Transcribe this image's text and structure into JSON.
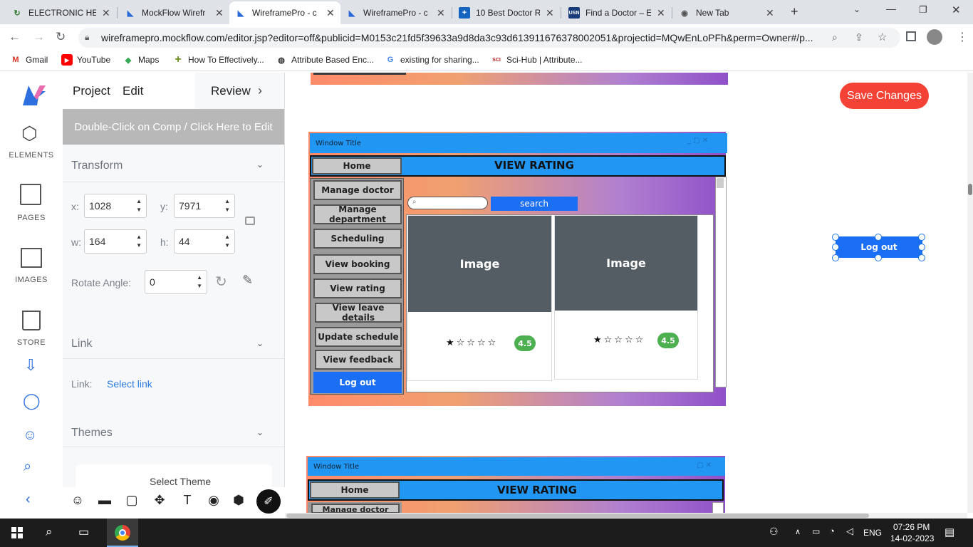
{
  "tabs": [
    {
      "label": "ELECTRONIC HEA",
      "icon": "electronic-health-icon",
      "active": false
    },
    {
      "label": "MockFlow Wirefr",
      "icon": "mockflow-icon",
      "active": false
    },
    {
      "label": "WireframePro - c",
      "icon": "mockflow-icon",
      "active": true
    },
    {
      "label": "WireframePro - c",
      "icon": "mockflow-icon",
      "active": false
    },
    {
      "label": "10 Best Doctor R",
      "icon": "doctor-icon",
      "active": false
    },
    {
      "label": "Find a Doctor – E",
      "icon": "usn-icon",
      "active": false
    },
    {
      "label": "New Tab",
      "icon": "chrome-icon",
      "active": false
    }
  ],
  "address": {
    "url": "wireframepro.mockflow.com/editor.jsp?editor=off&publicid=M0153c21fd5f39633a9d8da3c93d613911676378002051&projectid=MQwEnLoPFh&perm=Owner#/p..."
  },
  "bookmarks": [
    {
      "label": "Gmail",
      "icon": "gmail-icon"
    },
    {
      "label": "YouTube",
      "icon": "youtube-icon"
    },
    {
      "label": "Maps",
      "icon": "maps-icon"
    },
    {
      "label": "How To Effectively...",
      "icon": "plus-icon"
    },
    {
      "label": "Attribute Based Enc...",
      "icon": "globe-icon"
    },
    {
      "label": "existing for sharing...",
      "icon": "google-icon"
    },
    {
      "label": "Sci-Hub | Attribute...",
      "icon": "scihub-icon"
    }
  ],
  "rail": {
    "elements": "ELEMENTS",
    "pages": "PAGES",
    "images": "IMAGES",
    "store": "STORE"
  },
  "menu": {
    "project": "Project",
    "edit": "Edit",
    "review": "Review"
  },
  "panel": {
    "edit_hint": "Double-Click on Comp / Click Here to Edit",
    "transform": "Transform",
    "x_label": "x:",
    "x_value": "1028",
    "y_label": "y:",
    "y_value": "7971",
    "w_label": "w:",
    "w_value": "164",
    "h_label": "h:",
    "h_value": "44",
    "rotate_label": "Rotate Angle:",
    "rotate_value": "0",
    "link_header": "Link",
    "link_label": "Link:",
    "link_value": "Select link",
    "themes_header": "Themes",
    "select_theme": "Select Theme"
  },
  "canvas": {
    "save_changes": "Save Changes",
    "window_title": "Window Title",
    "home": "Home",
    "view_rating": "VIEW RATING",
    "sidebar": [
      "Manage doctor",
      "Manage department",
      "Scheduling",
      "View booking",
      "View rating",
      "View leave details",
      "Update schedule",
      "View feedback"
    ],
    "logout": "Log out",
    "search_btn": "search",
    "cards": [
      {
        "image_label": "Image",
        "rating": "4.5",
        "stars": "★☆☆☆☆"
      },
      {
        "image_label": "Image",
        "rating": "4.5",
        "stars": "★☆☆☆☆"
      }
    ],
    "selected_logout": "Log out",
    "window2_title": "Window Title",
    "home2": "Home",
    "view_rating2": "VIEW RATING",
    "manage_doctor2": "Manage doctor"
  },
  "taskbar": {
    "lang": "ENG",
    "time": "07:26 PM",
    "date": "14-02-2023"
  }
}
